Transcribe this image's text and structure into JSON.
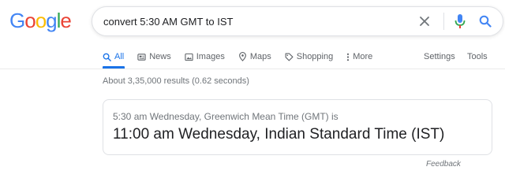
{
  "logo": {
    "letters": [
      "G",
      "o",
      "o",
      "g",
      "l",
      "e"
    ],
    "colors": [
      "#4285f4",
      "#ea4335",
      "#fbbc05",
      "#4285f4",
      "#34a853",
      "#ea4335"
    ]
  },
  "search": {
    "value": "convert 5:30 AM GMT to IST"
  },
  "tabs": [
    {
      "label": "All",
      "icon": "search-icon",
      "active": true
    },
    {
      "label": "News",
      "icon": "news-icon",
      "active": false
    },
    {
      "label": "Images",
      "icon": "image-icon",
      "active": false
    },
    {
      "label": "Maps",
      "icon": "map-pin-icon",
      "active": false
    },
    {
      "label": "Shopping",
      "icon": "tag-icon",
      "active": false
    },
    {
      "label": "More",
      "icon": "more-vertical-icon",
      "active": false
    }
  ],
  "tools": {
    "settings_label": "Settings",
    "tools_label": "Tools"
  },
  "result_stats": "About 3,35,000 results (0.62 seconds)",
  "answer": {
    "source_text": "5:30 am Wednesday, Greenwich Mean Time (GMT) is",
    "result_text": "11:00 am Wednesday, Indian Standard Time (IST)"
  },
  "feedback_label": "Feedback",
  "colors": {
    "accent": "#1a73e8",
    "mic_blue": "#4285f4",
    "mic_red": "#ea4335"
  }
}
